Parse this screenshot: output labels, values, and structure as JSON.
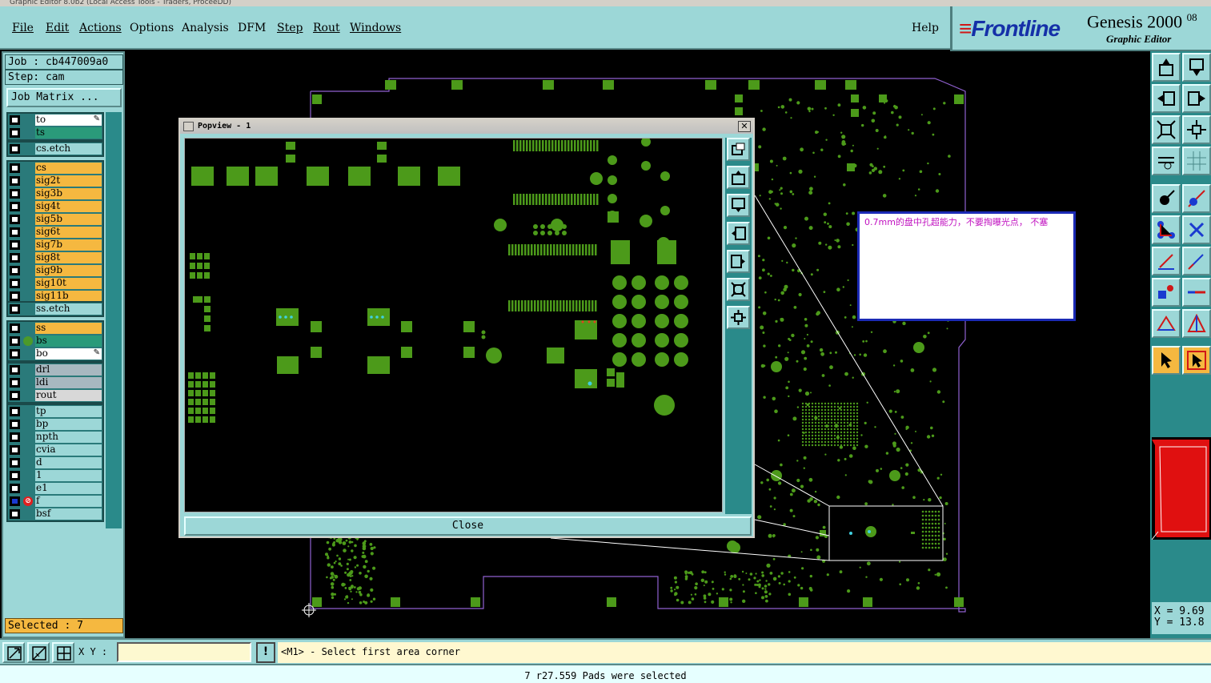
{
  "window": {
    "title": "Graphic Editor 8.0b2 (Local Access Tools - Traders, ProceeDD)"
  },
  "menubar": {
    "file": "File",
    "edit": "Edit",
    "actions": "Actions",
    "options": "Options",
    "analysis": "Analysis",
    "dfm": "DFM",
    "step": "Step",
    "rout": "Rout",
    "windows": "Windows",
    "help": "Help"
  },
  "brand": {
    "logo": "Frontline",
    "product": "Genesis 2000",
    "version": "08",
    "subtitle": "Graphic Editor"
  },
  "job": {
    "job_label": "Job : cb447009a0",
    "step_label": "Step: cam",
    "matrix_button": "Job Matrix ..."
  },
  "layers": [
    {
      "group": 0,
      "name": "to",
      "color": "#ffffff",
      "pen": true
    },
    {
      "group": 0,
      "name": "ts",
      "color": "#2a9a7a",
      "pen": false
    },
    {
      "group": 1,
      "name": "cs.etch",
      "color": "#9cd7d7",
      "pen": false
    },
    {
      "group": 2,
      "name": "cs",
      "color": "#f5b840",
      "pen": false
    },
    {
      "group": 2,
      "name": "sig2t",
      "color": "#f5b840",
      "pen": false
    },
    {
      "group": 2,
      "name": "sig3b",
      "color": "#f5b840",
      "pen": false
    },
    {
      "group": 2,
      "name": "sig4t",
      "color": "#f5b840",
      "pen": false
    },
    {
      "group": 2,
      "name": "sig5b",
      "color": "#f5b840",
      "pen": false
    },
    {
      "group": 2,
      "name": "sig6t",
      "color": "#f5b840",
      "pen": false
    },
    {
      "group": 2,
      "name": "sig7b",
      "color": "#f5b840",
      "pen": false
    },
    {
      "group": 2,
      "name": "sig8t",
      "color": "#f5b840",
      "pen": false
    },
    {
      "group": 2,
      "name": "sig9b",
      "color": "#f5b840",
      "pen": false
    },
    {
      "group": 2,
      "name": "sig10t",
      "color": "#f5b840",
      "pen": false
    },
    {
      "group": 2,
      "name": "sig11b",
      "color": "#f5b840",
      "pen": false
    },
    {
      "group": 3,
      "name": "ss.etch",
      "color": "#9cd7d7",
      "pen": false
    },
    {
      "group": 4,
      "name": "ss",
      "color": "#f5b840",
      "pen": false
    },
    {
      "group": 4,
      "name": "bs",
      "color": "#2a9a7a",
      "pen": false,
      "active": true
    },
    {
      "group": 4,
      "name": "bo",
      "color": "#ffffff",
      "pen": true
    },
    {
      "group": 5,
      "name": "drl",
      "color": "#a8b8c0",
      "pen": false
    },
    {
      "group": 5,
      "name": "ldi",
      "color": "#a8b8c0",
      "pen": false
    },
    {
      "group": 5,
      "name": "rout",
      "color": "#d8d8d8",
      "pen": false
    },
    {
      "group": 6,
      "name": "tp",
      "color": "#9cd7d7",
      "pen": false
    },
    {
      "group": 6,
      "name": "bp",
      "color": "#9cd7d7",
      "pen": false
    },
    {
      "group": 6,
      "name": "npth",
      "color": "#9cd7d7",
      "pen": false
    },
    {
      "group": 6,
      "name": "cvia",
      "color": "#9cd7d7",
      "pen": false
    },
    {
      "group": 6,
      "name": "d",
      "color": "#9cd7d7",
      "pen": false
    },
    {
      "group": 6,
      "name": "1",
      "color": "#9cd7d7",
      "pen": false
    },
    {
      "group": 6,
      "name": "e1",
      "color": "#9cd7d7",
      "pen": false
    },
    {
      "group": 6,
      "name": "f",
      "color": "#9cd7d7",
      "pen": false,
      "noicon": true,
      "on": true
    },
    {
      "group": 6,
      "name": "bsf",
      "color": "#9cd7d7",
      "pen": false
    }
  ],
  "selected": "Selected : 7",
  "popview": {
    "title": "Popview - 1",
    "close_button": "Close"
  },
  "note": {
    "text": "0.7mm的盘中孔超能力，不要掏曝光点， 不塞"
  },
  "coords": {
    "x": "X = 9.69",
    "y": "Y = 13.8"
  },
  "input": {
    "xy_label": "X Y :",
    "xy_value": ""
  },
  "prompt": "<M1> - Select first area corner",
  "status": "7 r27.559 Pads were selected",
  "colors": {
    "copper": "#4c9a1a",
    "panel": "#9cd7d7",
    "dark_panel": "#2a8a8a",
    "outline": "#9060d0",
    "highlight": "#f5b840"
  }
}
